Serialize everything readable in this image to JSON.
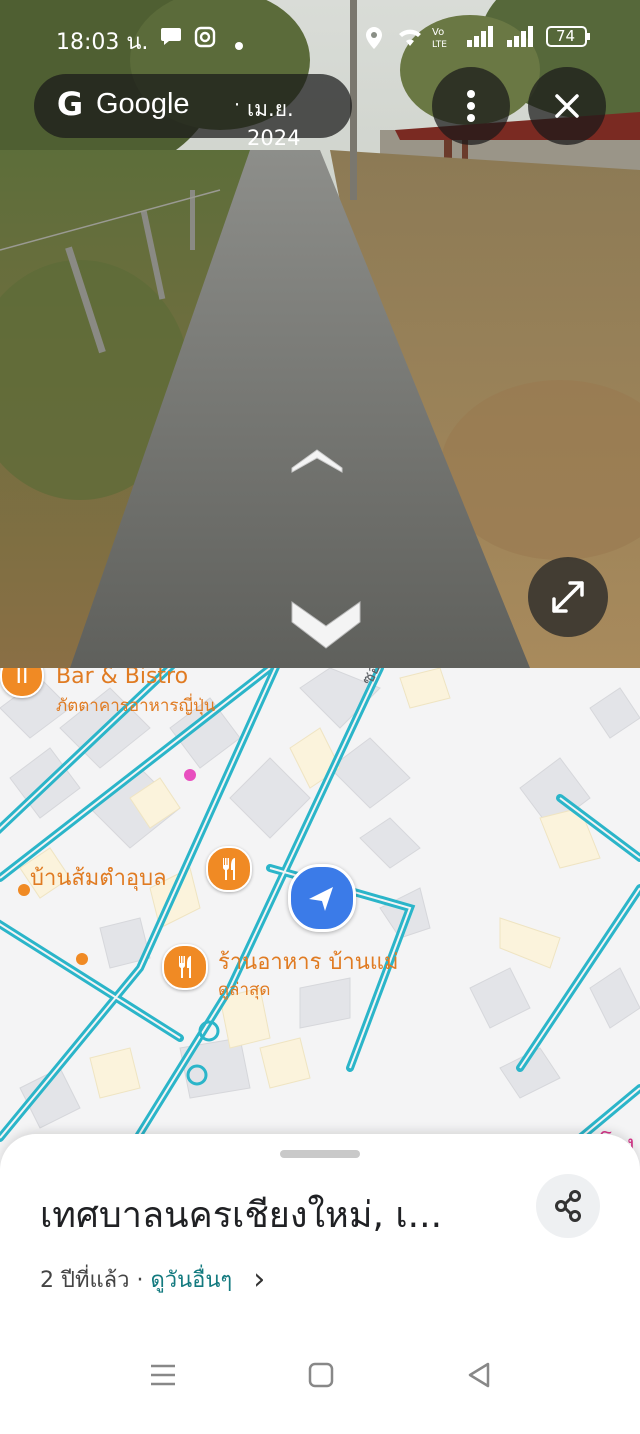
{
  "status_bar": {
    "time": "18:03 น.",
    "battery": "74",
    "icons": [
      "chat-icon",
      "instagram-icon",
      "dot-icon",
      "location-icon",
      "wifi-icon",
      "volte-icon",
      "signal-icon",
      "signal-icon",
      "battery-icon"
    ]
  },
  "streetview": {
    "brand": "Google",
    "separator": "·",
    "capture_date": "เม.ย. 2024",
    "more_icon": "more-vert-icon",
    "close_icon": "close-icon",
    "expand_icon": "expand-icon",
    "forward_icon": "chevron-up-icon",
    "back_icon": "chevron-down-icon"
  },
  "map": {
    "labels": {
      "bar_bistro": "Bar & Bistro",
      "restaurant_japanese": "ภัตตาคารอาหารญี่ปุ่น",
      "somtum": "บ้านส้มตำอุบล",
      "baanmae": "ร้านอาหาร บ้านแม่",
      "most_viewed": "ดูล่าสุด",
      "soi": "ซอย",
      "rong": "โรง"
    },
    "accent": "#2bb5c9",
    "poi_color": "#f08a24"
  },
  "sheet": {
    "title": "เทศบาลนครเชียงใหม่, เ...",
    "age": "2 ปีที่แล้ว",
    "dot": "·",
    "see_more": "ดูวันอื่นๆ",
    "chevron": "›"
  },
  "nav_bar": {
    "icons": [
      "menu-icon",
      "home-icon",
      "back-icon"
    ]
  }
}
